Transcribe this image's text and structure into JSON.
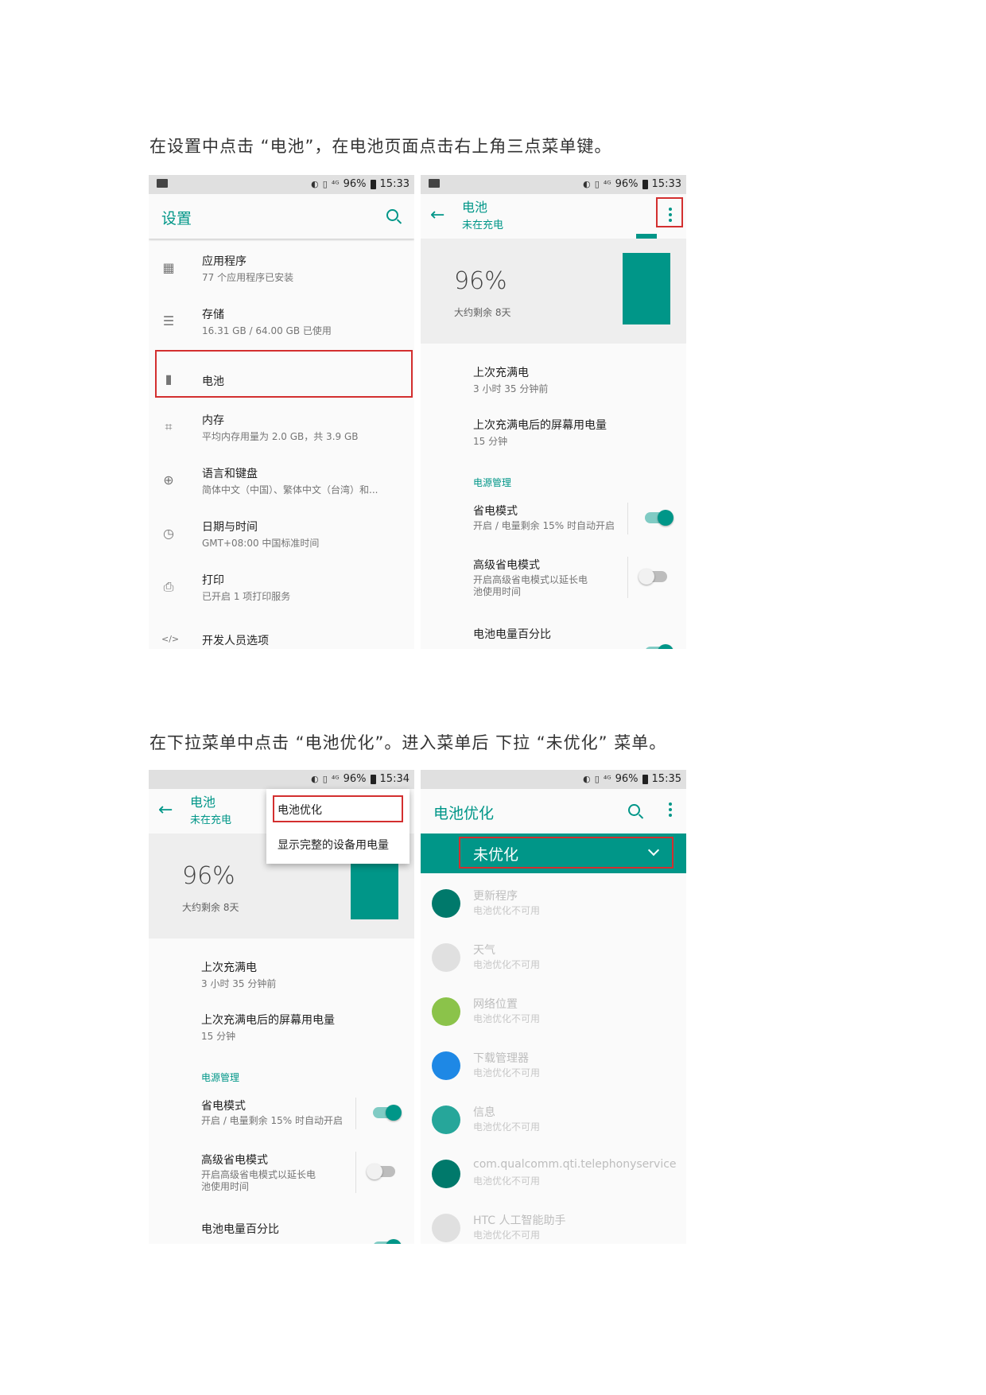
{
  "captions": {
    "first": "在设置中点击 “电池”，在电池页面点击右上角三点菜单键。",
    "second": "在下拉菜单中点击 “电池优化”。进入菜单后  下拉 “未优化” 菜单。"
  },
  "status": {
    "pct": "96%",
    "sig": "⁴ᴳ",
    "time1": "15:33",
    "time2": "15:33",
    "time3": "15:34",
    "time4": "15:35"
  },
  "settings": {
    "title": "设置",
    "items": [
      {
        "title": "应用程序",
        "sub": "77 个应用程序已安装",
        "icon": "apps-icon"
      },
      {
        "title": "存储",
        "sub": "16.31 GB / 64.00 GB 已使用",
        "icon": "storage-icon"
      },
      {
        "title": "电池",
        "sub": "",
        "icon": "battery-icon"
      },
      {
        "title": "内存",
        "sub": "平均内存用量为 2.0 GB，共 3.9 GB",
        "icon": "memory-icon"
      },
      {
        "title": "语言和键盘",
        "sub": "简体中文（中国）、繁体中文（台湾）和...",
        "icon": "globe-icon"
      },
      {
        "title": "日期与时间",
        "sub": "GMT+08:00 中国标准时间",
        "icon": "clock-icon"
      },
      {
        "title": "打印",
        "sub": "已开启 1 项打印服务",
        "icon": "print-icon"
      },
      {
        "title": "开发人员选项",
        "sub": "",
        "icon": "code-icon"
      }
    ]
  },
  "battery": {
    "title": "电池",
    "subtitle": "未在充电",
    "percent": "96%",
    "remaining": "大约剩余 8天",
    "level": 0.96,
    "last_full_title": "上次充满电",
    "last_full_sub": "3 小时 35 分钟前",
    "screen_usage_title": "上次充满电后的屏幕用电量",
    "screen_usage_sub": "15 分钟",
    "section": "电源管理",
    "saver_title": "省电模式",
    "saver_sub": "开启 / 电量剩余 15% 时自动开启",
    "saver_on": true,
    "adv_saver_title": "高级省电模式",
    "adv_saver_sub1": "开启高级省电模式以延长电",
    "adv_saver_sub2": "池使用时间",
    "adv_saver_on": false,
    "percent_title": "电池电量百分比",
    "percent_on": true
  },
  "overflow_menu": {
    "item1": "电池优化",
    "item2": "显示完整的设备用电量"
  },
  "optimization": {
    "title": "电池优化",
    "filter": "未优化",
    "unavailable": "电池优化不可用",
    "apps": [
      {
        "name": "更新程序",
        "icon": "android-dark-icon",
        "color": "#00796b"
      },
      {
        "name": "天气",
        "icon": "weather-icon",
        "color": "#e0e0e0"
      },
      {
        "name": "网络位置",
        "icon": "android-green-icon",
        "color": "#8bc34a"
      },
      {
        "name": "下载管理器",
        "icon": "download-icon",
        "color": "#1e88e5"
      },
      {
        "name": "信息",
        "icon": "messages-icon",
        "color": "#26a69a"
      },
      {
        "name": "com.qualcomm.qti.telephonyservice",
        "icon": "android-dark-icon",
        "color": "#00796b"
      },
      {
        "name": "HTC 人工智能助手",
        "icon": "assistant-icon",
        "color": "#e0e0e0"
      }
    ]
  },
  "colors": {
    "accent": "#009688",
    "highlight": "#d32f2f"
  }
}
